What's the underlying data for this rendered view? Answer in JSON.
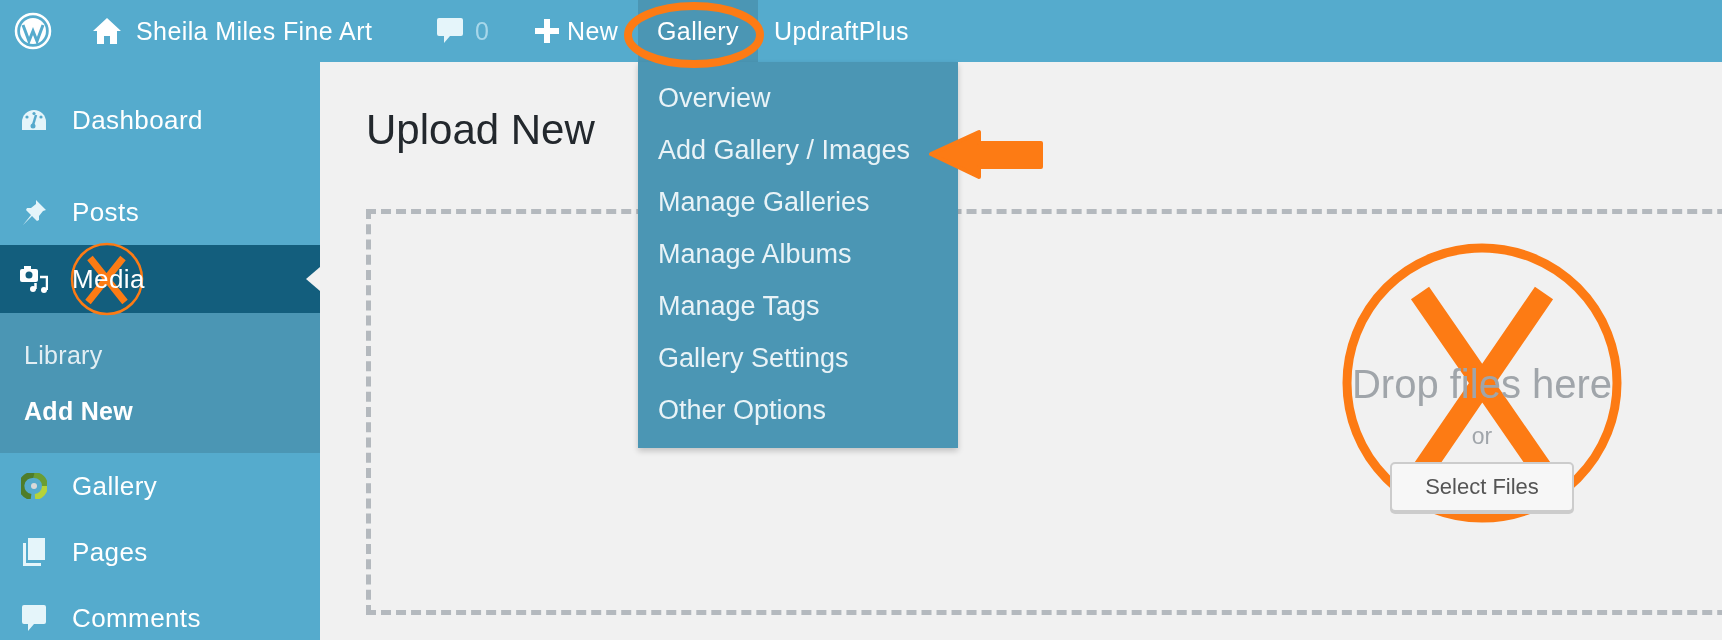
{
  "admin_bar": {
    "site_name": "Sheila Miles Fine Art",
    "comments_count": "0",
    "new_label": "New",
    "items": [
      {
        "label": "Gallery",
        "selected": true
      },
      {
        "label": "UpdraftPlus",
        "selected": false
      }
    ]
  },
  "gallery_menu": {
    "open": true,
    "items": [
      {
        "label": "Overview"
      },
      {
        "label": "Add Gallery / Images"
      },
      {
        "label": "Manage Galleries"
      },
      {
        "label": "Manage Albums"
      },
      {
        "label": "Manage Tags"
      },
      {
        "label": "Gallery Settings"
      },
      {
        "label": "Other Options"
      }
    ]
  },
  "sidebar": {
    "items": [
      {
        "label": "Dashboard",
        "selected": false
      },
      {
        "label": "Posts",
        "selected": false
      },
      {
        "label": "Media",
        "selected": true,
        "children": [
          {
            "label": "Library",
            "selected": false
          },
          {
            "label": "Add New",
            "selected": true
          }
        ]
      },
      {
        "label": "Gallery",
        "selected": false
      },
      {
        "label": "Pages",
        "selected": false
      },
      {
        "label": "Comments",
        "selected": false
      }
    ]
  },
  "content": {
    "title": "Upload New",
    "drop_text": "Drop files here",
    "or_text": "or",
    "button": "Select Files"
  }
}
